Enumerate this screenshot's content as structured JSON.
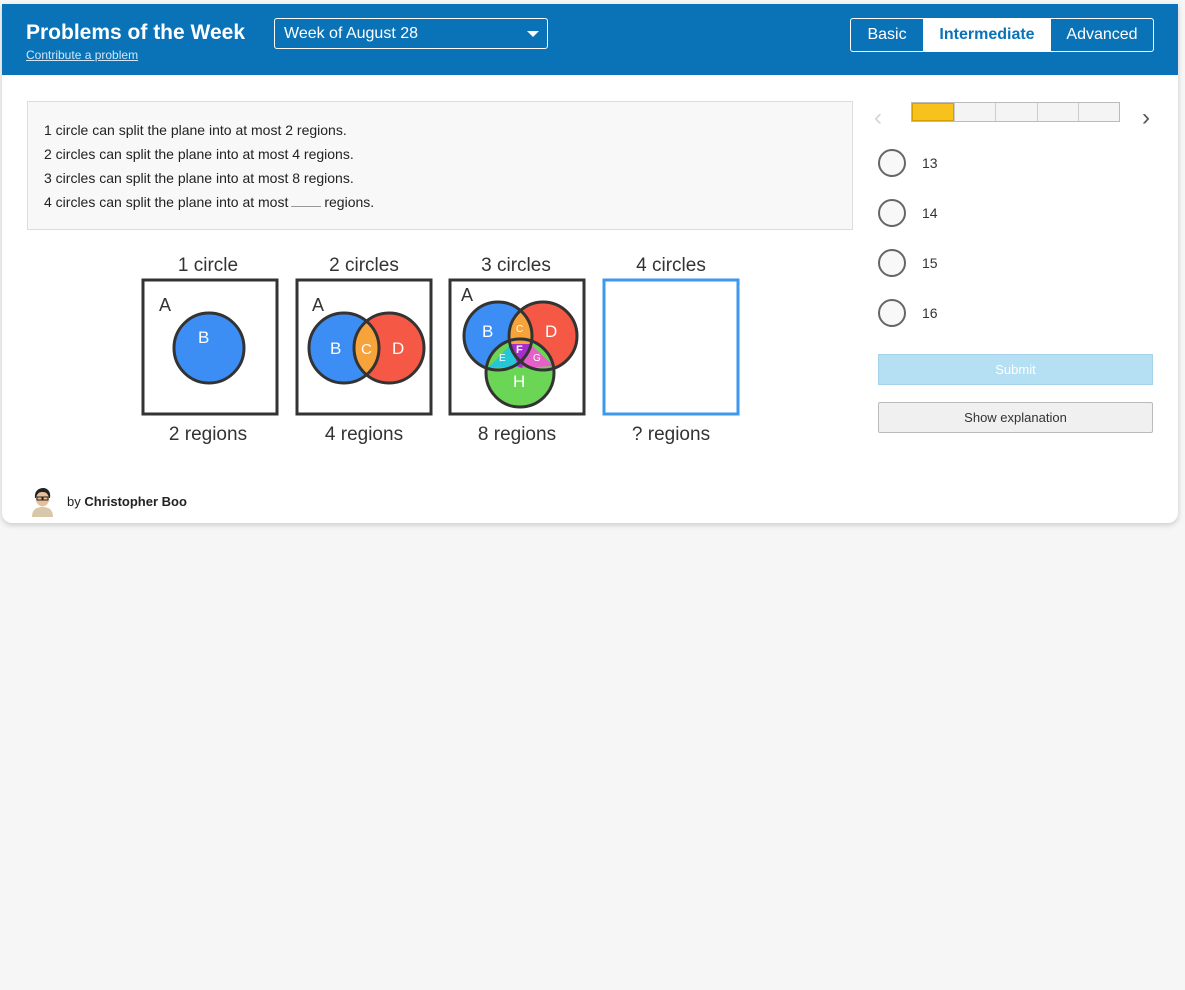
{
  "header": {
    "title": "Problems of the Week",
    "contribute_link": "Contribute a problem",
    "week_select_value": "Week of August 28",
    "levels": [
      "Basic",
      "Intermediate",
      "Advanced"
    ],
    "active_level": "Intermediate"
  },
  "colors": {
    "header_bg": "#0a73b8",
    "progress_fill": "#f8c21c",
    "submit_bg": "#b5dff3",
    "circle_blue": "#3c8ef5",
    "circle_red": "#f55844",
    "region_orange": "#f5a33a",
    "circle_green": "#6bd655",
    "region_cyan": "#26c6d9",
    "region_purple": "#a62fc9",
    "region_pink": "#e660c8",
    "answer_box_border": "#3c99ee"
  },
  "problem": {
    "lines": [
      "1 circle can split the plane into at most 2 regions.",
      "2 circles can split the plane into at most 4 regions.",
      "3 circles can split the plane into at most 8 regions."
    ],
    "last_line_before": "4 circles can split the plane into at most",
    "last_line_after": "regions."
  },
  "figure": {
    "panels": [
      {
        "top": "1 circle",
        "bottom": "2 regions",
        "labels": [
          "A",
          "B"
        ]
      },
      {
        "top": "2 circles",
        "bottom": "4 regions",
        "labels": [
          "A",
          "B",
          "C",
          "D"
        ]
      },
      {
        "top": "3 circles",
        "bottom": "8 regions",
        "labels": [
          "A",
          "B",
          "C",
          "D",
          "E",
          "F",
          "G",
          "H"
        ]
      },
      {
        "top": "4 circles",
        "bottom": "? regions",
        "labels": []
      }
    ]
  },
  "progress": {
    "current": 1,
    "total": 5,
    "fraction": 0.2
  },
  "options": [
    "13",
    "14",
    "15",
    "16"
  ],
  "buttons": {
    "submit": "Submit",
    "explanation": "Show explanation"
  },
  "author": {
    "prefix": "by",
    "name": "Christopher Boo"
  }
}
